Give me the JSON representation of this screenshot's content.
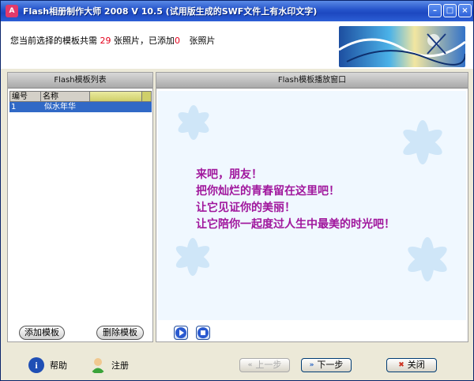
{
  "window": {
    "title": "Flash相册制作大师 2008 V 10.5 (试用版生成的SWF文件上有水印文字)",
    "app_icon_text": "A",
    "minimize_icon": "minimize-icon",
    "maximize_icon": "maximize-icon",
    "close_icon": "close-icon"
  },
  "status": {
    "prefix": "您当前选择的模板共需",
    "required_count": "29",
    "mid": "张照片，已添加",
    "added_count": "0",
    "suffix": "张照片"
  },
  "left_panel": {
    "title": "Flash模板列表",
    "columns": [
      "编号",
      "名称"
    ],
    "rows": [
      {
        "id": "1",
        "name": "似水年华"
      }
    ],
    "add_button": "添加模板",
    "delete_button": "删除模板"
  },
  "right_panel": {
    "title": "Flash模板播放窗口",
    "poem_lines": [
      "来吧，朋友！",
      "把你灿烂的青春留在这里吧！",
      "让它见证你的美丽！",
      "让它陪你一起度过人生中最美的时光吧！"
    ],
    "play_icon": "play-icon",
    "stop_icon": "stop-icon"
  },
  "footer": {
    "help_label": "帮助",
    "register_label": "注册",
    "prev_label": "上一步",
    "next_label": "下一步",
    "close_label": "关闭"
  },
  "colors": {
    "accent": "#2452c9",
    "count_red": "#e4001b",
    "poem_purple": "#a0179d",
    "selection_blue": "#3169c6"
  }
}
